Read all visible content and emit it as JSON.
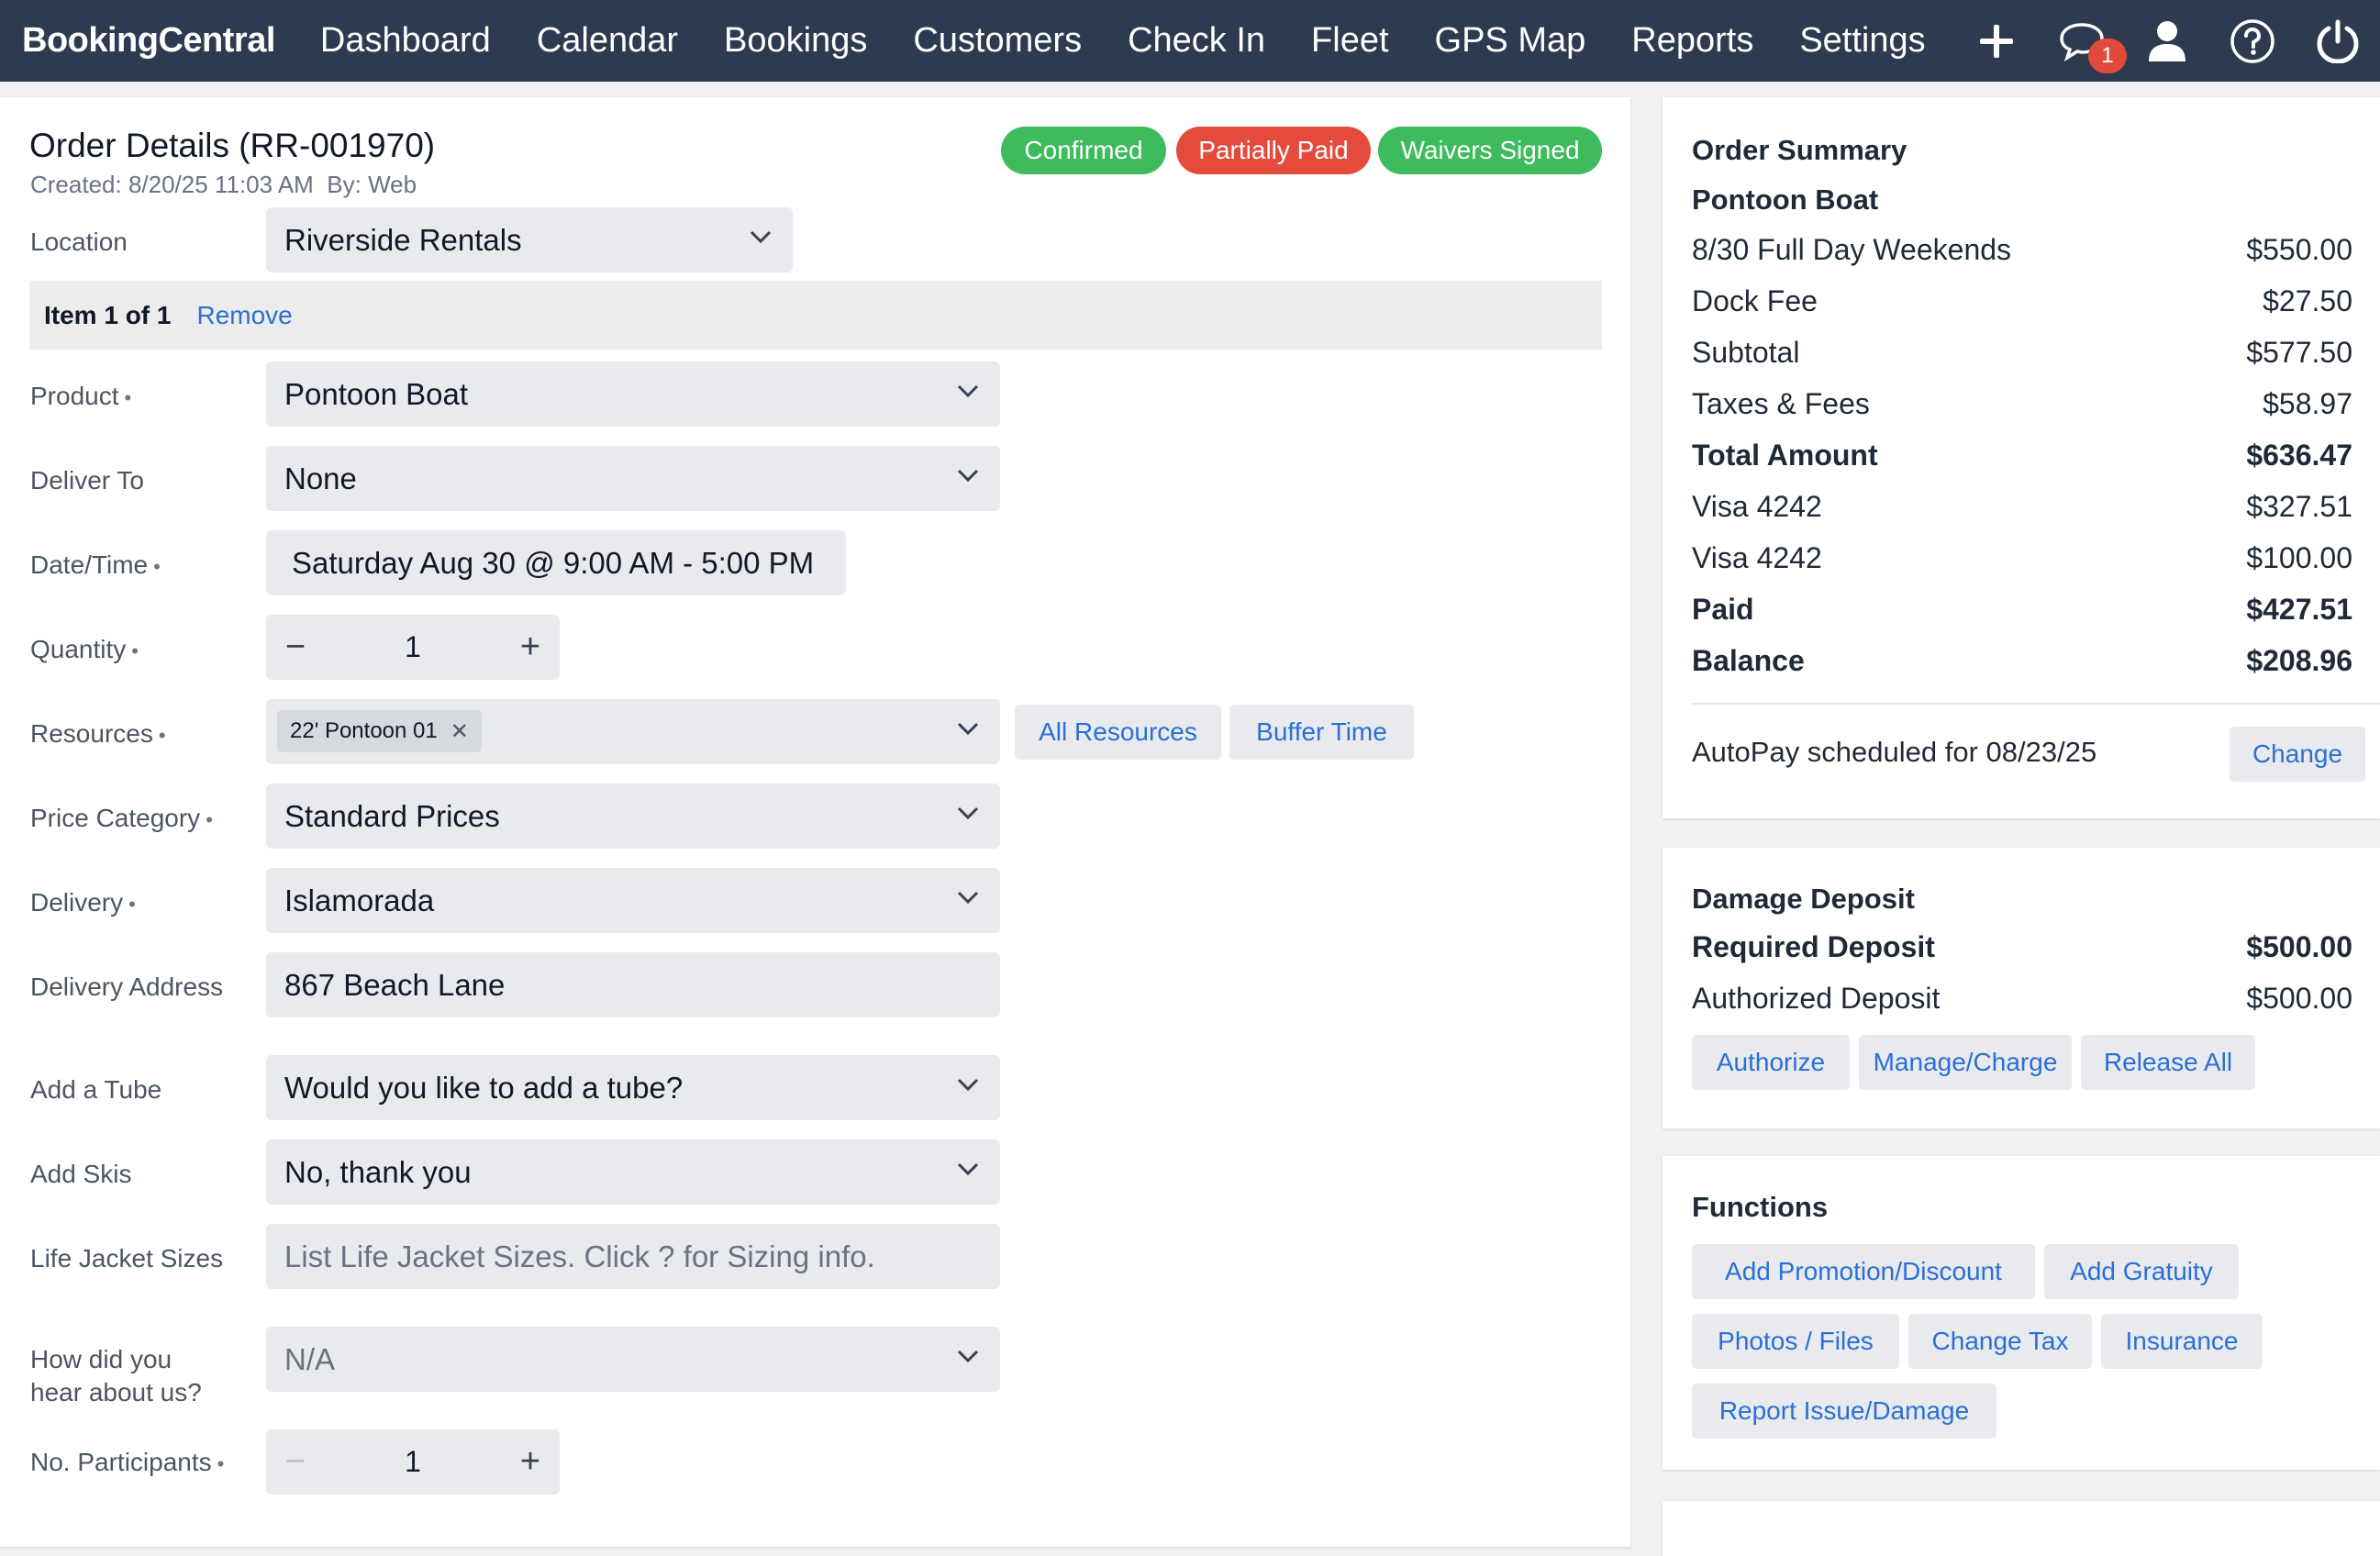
{
  "nav": {
    "brand": "BookingCentral",
    "items": [
      "Dashboard",
      "Calendar",
      "Bookings",
      "Customers",
      "Check In",
      "Fleet",
      "GPS Map",
      "Reports",
      "Settings"
    ],
    "icons": [
      "plus-icon",
      "chat-icon",
      "user-icon",
      "help-icon",
      "power-icon"
    ],
    "chat_badge": "1"
  },
  "order": {
    "title": "Order Details (RR-001970)",
    "created": "Created: 8/20/25 11:03 AM",
    "by": "By: Web",
    "statuses": [
      {
        "label": "Confirmed",
        "color": "#3dbb5d"
      },
      {
        "label": "Partially Paid",
        "color": "#e44b3c"
      },
      {
        "label": "Waivers Signed",
        "color": "#3dbb5d"
      }
    ],
    "location_label": "Location",
    "location_value": "Riverside Rentals",
    "item_label": "Item 1 of 1",
    "remove_label": "Remove",
    "fields": {
      "product": {
        "label": "Product",
        "value": "Pontoon Boat"
      },
      "deliver_to": {
        "label": "Deliver To",
        "value": "None"
      },
      "datetime": {
        "label": "Date/Time",
        "value": "Saturday Aug 30 @ 9:00 AM - 5:00 PM"
      },
      "quantity": {
        "label": "Quantity",
        "value": "1"
      },
      "resources": {
        "label": "Resources",
        "chip": "22' Pontoon 01",
        "all_resources": "All Resources",
        "buffer_time": "Buffer Time"
      },
      "price_category": {
        "label": "Price Category",
        "value": "Standard Prices"
      },
      "delivery": {
        "label": "Delivery",
        "value": "Islamorada"
      },
      "delivery_address": {
        "label": "Delivery Address",
        "value": "867 Beach Lane"
      },
      "add_tube": {
        "label": "Add a Tube",
        "value": "Would you like to add a tube?"
      },
      "add_skis": {
        "label": "Add Skis",
        "value": "No, thank you"
      },
      "life_jacket": {
        "label": "Life Jacket Sizes",
        "placeholder": "List Life Jacket Sizes. Click ? for Sizing info."
      },
      "hear_about": {
        "label_1": "How did you",
        "label_2": "hear about us?",
        "value": "N/A"
      },
      "participants": {
        "label": "No. Participants",
        "value": "1"
      }
    }
  },
  "summary": {
    "title": "Order Summary",
    "product": "Pontoon Boat",
    "rows": [
      {
        "label": "8/30 Full Day Weekends",
        "value": "$550.00",
        "bold": false
      },
      {
        "label": "Dock Fee",
        "value": "$27.50",
        "bold": false
      },
      {
        "label": "Subtotal",
        "value": "$577.50",
        "bold": false
      },
      {
        "label": "Taxes & Fees",
        "value": "$58.97",
        "bold": false
      },
      {
        "label": "Total Amount",
        "value": "$636.47",
        "bold": true
      },
      {
        "label": "Visa 4242",
        "value": "$327.51",
        "bold": false
      },
      {
        "label": "Visa 4242",
        "value": "$100.00",
        "bold": false
      },
      {
        "label": "Paid",
        "value": "$427.51",
        "bold": true
      },
      {
        "label": "Balance",
        "value": "$208.96",
        "bold": true
      }
    ],
    "autopay": "AutoPay scheduled for 08/23/25",
    "change_label": "Change"
  },
  "deposit": {
    "title": "Damage Deposit",
    "required_label": "Required Deposit",
    "required_value": "$500.00",
    "authorized_label": "Authorized Deposit",
    "authorized_value": "$500.00",
    "buttons": [
      "Authorize",
      "Manage/Charge",
      "Release All"
    ]
  },
  "functions": {
    "title": "Functions",
    "buttons": [
      "Add Promotion/Discount",
      "Add Gratuity",
      "Photos / Files",
      "Change Tax",
      "Insurance",
      "Report Issue/Damage"
    ]
  }
}
